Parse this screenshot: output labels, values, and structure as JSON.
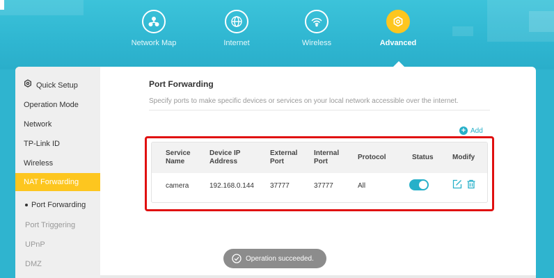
{
  "colors": {
    "header_bg": "#2fb4cf",
    "accent_yellow": "#fdc61f",
    "accent_teal": "#27b0c9",
    "highlight_red": "#e01010",
    "toast_bg": "#8c8c8c"
  },
  "nav": {
    "items": [
      {
        "label": "Network Map",
        "icon": "network-map-icon"
      },
      {
        "label": "Internet",
        "icon": "globe-icon"
      },
      {
        "label": "Wireless",
        "icon": "wifi-icon"
      },
      {
        "label": "Advanced",
        "icon": "gear-icon",
        "active": true
      }
    ]
  },
  "sidebar": {
    "items": [
      {
        "label": "Quick Setup",
        "icon": "gear-icon"
      },
      {
        "label": "Operation Mode"
      },
      {
        "label": "Network"
      },
      {
        "label": "TP-Link ID"
      },
      {
        "label": "Wireless"
      },
      {
        "label": "NAT Forwarding",
        "active": true
      },
      {
        "label": "Port Forwarding",
        "current": true
      },
      {
        "label": "Port Triggering"
      },
      {
        "label": "UPnP"
      },
      {
        "label": "DMZ"
      }
    ]
  },
  "main": {
    "title": "Port Forwarding",
    "description": "Specify ports to make specific devices or services on your local network accessible over the internet.",
    "add_label": "Add",
    "table": {
      "headers": {
        "service_name": [
          "Service",
          "Name"
        ],
        "device_ip": [
          "Device IP",
          "Address"
        ],
        "external_port": [
          "External",
          "Port"
        ],
        "internal_port": [
          "Internal",
          "Port"
        ],
        "protocol": "Protocol",
        "status": "Status",
        "modify": "Modify"
      },
      "rows": [
        {
          "service_name": "camera",
          "device_ip": "192.168.0.144",
          "external_port": "37777",
          "internal_port": "37777",
          "protocol": "All",
          "status_enabled": true,
          "modify_icons": [
            "edit-icon",
            "trash-icon"
          ]
        }
      ]
    }
  },
  "toast": {
    "message": "Operation succeeded.",
    "icon": "check-circle-icon"
  }
}
